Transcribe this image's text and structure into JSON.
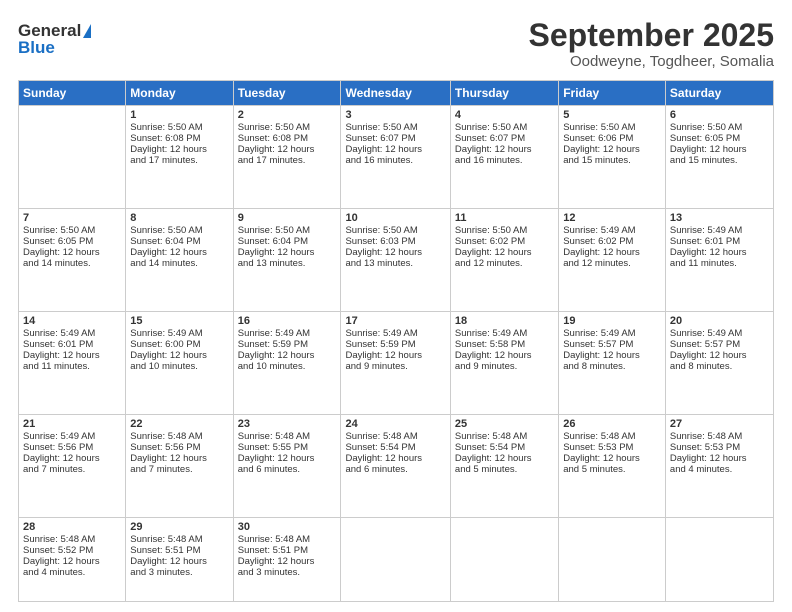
{
  "logo": {
    "general": "General",
    "blue": "Blue"
  },
  "title": "September 2025",
  "location": "Oodweyne, Togdheer, Somalia",
  "headers": [
    "Sunday",
    "Monday",
    "Tuesday",
    "Wednesday",
    "Thursday",
    "Friday",
    "Saturday"
  ],
  "weeks": [
    [
      {
        "day": "",
        "info": ""
      },
      {
        "day": "1",
        "info": "Sunrise: 5:50 AM\nSunset: 6:08 PM\nDaylight: 12 hours\nand 17 minutes."
      },
      {
        "day": "2",
        "info": "Sunrise: 5:50 AM\nSunset: 6:08 PM\nDaylight: 12 hours\nand 17 minutes."
      },
      {
        "day": "3",
        "info": "Sunrise: 5:50 AM\nSunset: 6:07 PM\nDaylight: 12 hours\nand 16 minutes."
      },
      {
        "day": "4",
        "info": "Sunrise: 5:50 AM\nSunset: 6:07 PM\nDaylight: 12 hours\nand 16 minutes."
      },
      {
        "day": "5",
        "info": "Sunrise: 5:50 AM\nSunset: 6:06 PM\nDaylight: 12 hours\nand 15 minutes."
      },
      {
        "day": "6",
        "info": "Sunrise: 5:50 AM\nSunset: 6:05 PM\nDaylight: 12 hours\nand 15 minutes."
      }
    ],
    [
      {
        "day": "7",
        "info": "Sunrise: 5:50 AM\nSunset: 6:05 PM\nDaylight: 12 hours\nand 14 minutes."
      },
      {
        "day": "8",
        "info": "Sunrise: 5:50 AM\nSunset: 6:04 PM\nDaylight: 12 hours\nand 14 minutes."
      },
      {
        "day": "9",
        "info": "Sunrise: 5:50 AM\nSunset: 6:04 PM\nDaylight: 12 hours\nand 13 minutes."
      },
      {
        "day": "10",
        "info": "Sunrise: 5:50 AM\nSunset: 6:03 PM\nDaylight: 12 hours\nand 13 minutes."
      },
      {
        "day": "11",
        "info": "Sunrise: 5:50 AM\nSunset: 6:02 PM\nDaylight: 12 hours\nand 12 minutes."
      },
      {
        "day": "12",
        "info": "Sunrise: 5:49 AM\nSunset: 6:02 PM\nDaylight: 12 hours\nand 12 minutes."
      },
      {
        "day": "13",
        "info": "Sunrise: 5:49 AM\nSunset: 6:01 PM\nDaylight: 12 hours\nand 11 minutes."
      }
    ],
    [
      {
        "day": "14",
        "info": "Sunrise: 5:49 AM\nSunset: 6:01 PM\nDaylight: 12 hours\nand 11 minutes."
      },
      {
        "day": "15",
        "info": "Sunrise: 5:49 AM\nSunset: 6:00 PM\nDaylight: 12 hours\nand 10 minutes."
      },
      {
        "day": "16",
        "info": "Sunrise: 5:49 AM\nSunset: 5:59 PM\nDaylight: 12 hours\nand 10 minutes."
      },
      {
        "day": "17",
        "info": "Sunrise: 5:49 AM\nSunset: 5:59 PM\nDaylight: 12 hours\nand 9 minutes."
      },
      {
        "day": "18",
        "info": "Sunrise: 5:49 AM\nSunset: 5:58 PM\nDaylight: 12 hours\nand 9 minutes."
      },
      {
        "day": "19",
        "info": "Sunrise: 5:49 AM\nSunset: 5:57 PM\nDaylight: 12 hours\nand 8 minutes."
      },
      {
        "day": "20",
        "info": "Sunrise: 5:49 AM\nSunset: 5:57 PM\nDaylight: 12 hours\nand 8 minutes."
      }
    ],
    [
      {
        "day": "21",
        "info": "Sunrise: 5:49 AM\nSunset: 5:56 PM\nDaylight: 12 hours\nand 7 minutes."
      },
      {
        "day": "22",
        "info": "Sunrise: 5:48 AM\nSunset: 5:56 PM\nDaylight: 12 hours\nand 7 minutes."
      },
      {
        "day": "23",
        "info": "Sunrise: 5:48 AM\nSunset: 5:55 PM\nDaylight: 12 hours\nand 6 minutes."
      },
      {
        "day": "24",
        "info": "Sunrise: 5:48 AM\nSunset: 5:54 PM\nDaylight: 12 hours\nand 6 minutes."
      },
      {
        "day": "25",
        "info": "Sunrise: 5:48 AM\nSunset: 5:54 PM\nDaylight: 12 hours\nand 5 minutes."
      },
      {
        "day": "26",
        "info": "Sunrise: 5:48 AM\nSunset: 5:53 PM\nDaylight: 12 hours\nand 5 minutes."
      },
      {
        "day": "27",
        "info": "Sunrise: 5:48 AM\nSunset: 5:53 PM\nDaylight: 12 hours\nand 4 minutes."
      }
    ],
    [
      {
        "day": "28",
        "info": "Sunrise: 5:48 AM\nSunset: 5:52 PM\nDaylight: 12 hours\nand 4 minutes."
      },
      {
        "day": "29",
        "info": "Sunrise: 5:48 AM\nSunset: 5:51 PM\nDaylight: 12 hours\nand 3 minutes."
      },
      {
        "day": "30",
        "info": "Sunrise: 5:48 AM\nSunset: 5:51 PM\nDaylight: 12 hours\nand 3 minutes."
      },
      {
        "day": "",
        "info": ""
      },
      {
        "day": "",
        "info": ""
      },
      {
        "day": "",
        "info": ""
      },
      {
        "day": "",
        "info": ""
      }
    ]
  ]
}
